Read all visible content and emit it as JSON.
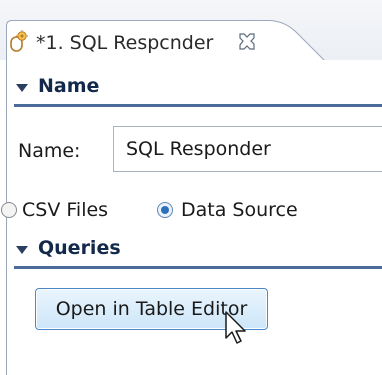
{
  "editor_tab": {
    "title": "*1. SQL Respcnder",
    "icon": "responder-icon",
    "close_icon": "close-icon"
  },
  "sections": {
    "name": {
      "title": "Name"
    },
    "queries": {
      "title": "Queries"
    }
  },
  "name_field": {
    "label": "Name:",
    "value": "SQL Responder"
  },
  "source_options": [
    {
      "label": "CSV Files",
      "selected": false
    },
    {
      "label": "Data Source",
      "selected": true
    }
  ],
  "queries": {
    "open_button_label": "Open in Table Editor"
  },
  "colors": {
    "section_title": "#13294b",
    "section_rule": "#4a6b9a",
    "button_border": "#4b88c7",
    "button_fill": "#cde6f9",
    "radio_selected": "#2f6fb8"
  }
}
